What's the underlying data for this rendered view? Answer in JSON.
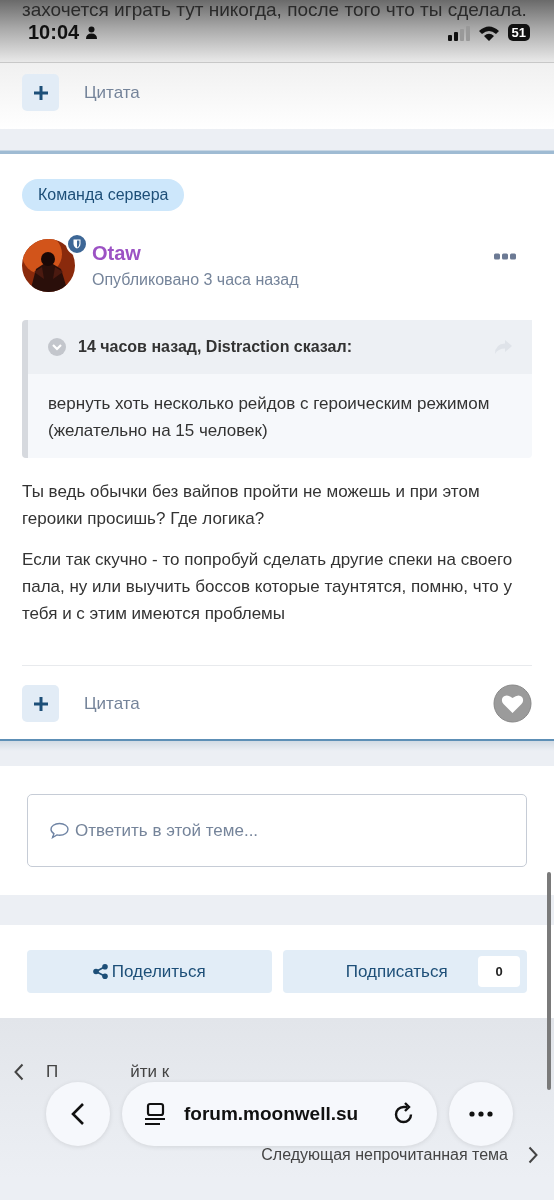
{
  "status_bar": {
    "cut_text": "захочется играть тут никогда, после того что ты сделала.",
    "time": "10:04",
    "battery": "51"
  },
  "previous_post": {
    "quote_label": "Цитата"
  },
  "post": {
    "group_badge": "Команда сервера",
    "author": "Otaw",
    "published": "Опубликовано 3 часа назад",
    "quote": {
      "header": "14 часов назад, Distraction сказал:",
      "text": "вернуть хоть несколько рейдов с героическим режимом (желательно на 15 человек)"
    },
    "paragraphs": [
      "Ты ведь обычки без вайпов пройти не можешь и при этом героики просишь? Где логика?",
      "Если так скучно - то попробуй сделать другие спеки на своего пала, ну или выучить боссов которые таунтятся, помню, что у тебя и с этим имеются проблемы"
    ],
    "quote_label": "Цитата",
    "liked": false
  },
  "reply": {
    "placeholder": "Ответить в этой теме..."
  },
  "actions": {
    "share": "Поделиться",
    "follow": "Подписаться",
    "follow_count": "0"
  },
  "navigation": {
    "previous": [
      "П",
      "йти к"
    ],
    "next": "Следующая непрочитанная тема"
  },
  "browser": {
    "url": "forum.moonwell.su"
  }
}
